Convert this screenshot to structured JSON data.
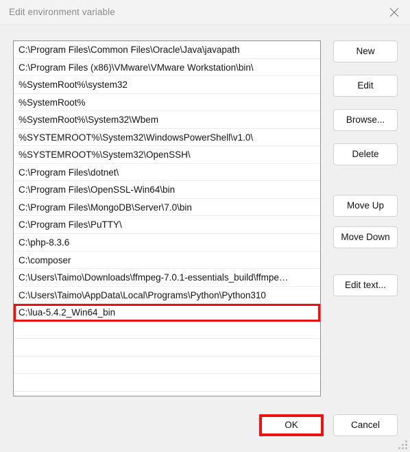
{
  "window": {
    "title": "Edit environment variable",
    "close_icon": "close-icon"
  },
  "list": {
    "items": [
      "C:\\Program Files\\Common Files\\Oracle\\Java\\javapath",
      "C:\\Program Files (x86)\\VMware\\VMware Workstation\\bin\\",
      "%SystemRoot%\\system32",
      "%SystemRoot%",
      "%SystemRoot%\\System32\\Wbem",
      "%SYSTEMROOT%\\System32\\WindowsPowerShell\\v1.0\\",
      "%SYSTEMROOT%\\System32\\OpenSSH\\",
      "C:\\Program Files\\dotnet\\",
      "C:\\Program Files\\OpenSSL-Win64\\bin",
      "C:\\Program Files\\MongoDB\\Server\\7.0\\bin",
      "C:\\Program Files\\PuTTY\\",
      "C:\\php-8.3.6",
      "C:\\composer",
      "C:\\Users\\Taimo\\Downloads\\ffmpeg-7.0.1-essentials_build\\ffmpe…",
      "C:\\Users\\Taimo\\AppData\\Local\\Programs\\Python\\Python310",
      "C:\\lua-5.4.2_Win64_bin",
      "",
      "",
      "",
      "",
      ""
    ],
    "highlighted_index": 15,
    "highlight_color": "#ee1111"
  },
  "side_buttons": {
    "new": "New",
    "edit": "Edit",
    "browse": "Browse...",
    "delete": "Delete",
    "move_up": "Move Up",
    "move_down": "Move Down",
    "edit_text": "Edit text..."
  },
  "footer": {
    "ok": "OK",
    "cancel": "Cancel"
  }
}
